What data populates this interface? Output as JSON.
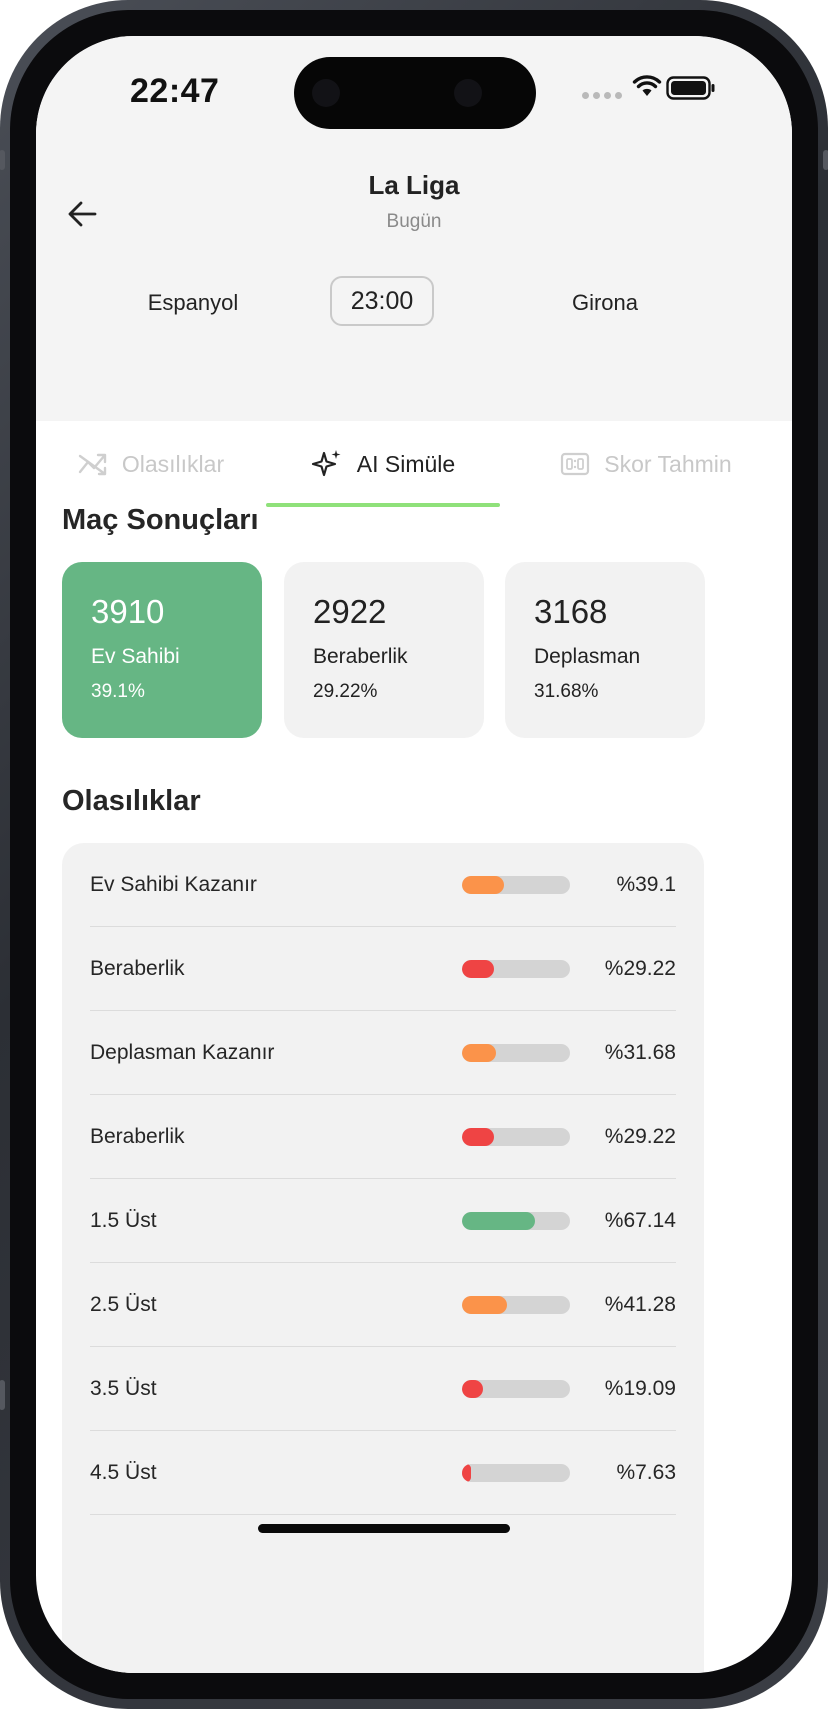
{
  "status_bar": {
    "time": "22:47"
  },
  "header": {
    "league": "La Liga",
    "date": "Bugün",
    "home_team": "Espanyol",
    "away_team": "Girona",
    "match_time": "23:00"
  },
  "tabs": [
    {
      "label": "Olasılıklar",
      "icon": "trend-icon",
      "active": false
    },
    {
      "label": "AI Simüle",
      "icon": "sparkle-icon",
      "active": true
    },
    {
      "label": "Skor Tahmin",
      "icon": "scoreboard-icon",
      "active": false
    }
  ],
  "results": {
    "title": "Maç Sonuçları",
    "cards": [
      {
        "count": "3910",
        "label": "Ev Sahibi",
        "percent": "39.1%"
      },
      {
        "count": "2922",
        "label": "Beraberlik",
        "percent": "29.22%"
      },
      {
        "count": "3168",
        "label": "Deplasman",
        "percent": "31.68%"
      }
    ]
  },
  "probabilities": {
    "title": "Olasılıklar",
    "rows": [
      {
        "label": "Ev Sahibi Kazanır",
        "value_text": "%39.1",
        "value": 39.1,
        "color": "#fb934a"
      },
      {
        "label": "Beraberlik",
        "value_text": "%29.22",
        "value": 29.22,
        "color": "#ef4444"
      },
      {
        "label": "Deplasman Kazanır",
        "value_text": "%31.68",
        "value": 31.68,
        "color": "#fb934a"
      },
      {
        "label": "Beraberlik",
        "value_text": "%29.22",
        "value": 29.22,
        "color": "#ef4444"
      },
      {
        "label": "1.5 Üst",
        "value_text": "%67.14",
        "value": 67.14,
        "color": "#66b684"
      },
      {
        "label": "2.5 Üst",
        "value_text": "%41.28",
        "value": 41.28,
        "color": "#fb934a"
      },
      {
        "label": "3.5 Üst",
        "value_text": "%19.09",
        "value": 19.09,
        "color": "#ef4444"
      },
      {
        "label": "4.5 Üst",
        "value_text": "%7.63",
        "value": 7.63,
        "color": "#ef4444"
      }
    ]
  },
  "colors": {
    "accent_green": "#66b684",
    "tab_underline": "#8fe17a",
    "warning_orange": "#fb934a",
    "danger_red": "#ef4444"
  }
}
